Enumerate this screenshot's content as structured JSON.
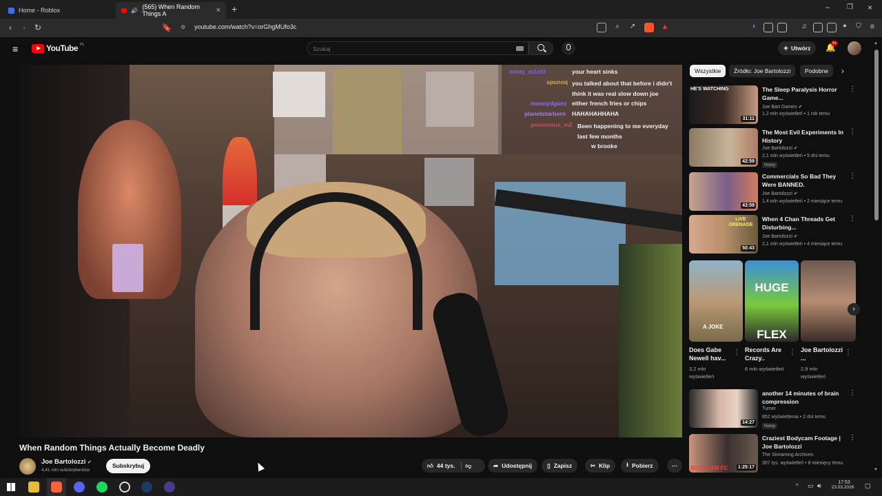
{
  "browser": {
    "tabs": [
      {
        "label": "Home - Roblox"
      },
      {
        "label": "(565) When Random Things A"
      }
    ],
    "url": "youtube.com/watch?v=orGhgMUfo3c"
  },
  "youtube": {
    "logo": "YouTube",
    "country": "PL",
    "search_placeholder": "Szukaj",
    "create_label": "Utwórz",
    "notif_count": "9+"
  },
  "chat": [
    {
      "user": "minty_m1sfit",
      "msg": "your heart sinks",
      "user_color": "#7f5fff"
    },
    {
      "user": "spunoq",
      "msg": "you talked about that before i didn't think it was real slow down joe",
      "user_color": "#e0a64a"
    },
    {
      "user": "mannydguez",
      "msg": "either french fries or chips",
      "user_color": "#8a6bff"
    },
    {
      "user": "planetstarborn",
      "msg": "HAHAHAHHAHA",
      "user_color": "#a57cff"
    },
    {
      "user": "poisonous_m2",
      "msg": "Been happening to me everyday last few months",
      "user_color": "#d24a6b"
    },
    {
      "user": "",
      "msg": "w brooke",
      "user_color": "#c02020"
    }
  ],
  "video": {
    "title": "When Random Things Actually Become Deadly",
    "channel": "Joe Bartolozzi",
    "subscribers": "4,41 mln subskrybentów",
    "subscribe_label": "Subskrybuj",
    "likes": "44 tys.",
    "share_label": "Udostępnij",
    "save_label": "Zapisz",
    "clip_label": "Klip",
    "download_label": "Pobierz"
  },
  "chips": [
    "Wszystkie",
    "Źródło: Joe Bartolozzi",
    "Podobne"
  ],
  "recommendations": [
    {
      "title": "The Sleep Paralysis Horror Game...",
      "channel": "Joe Bart Games",
      "meta": "1,2 mln wyświetleń • 1 rok temu",
      "duration": "31:11",
      "badge": "",
      "thumb_text": "HE'S WATCHING"
    },
    {
      "title": "The Most Evil Experiments In History",
      "channel": "Joe Bartolozzi",
      "meta": "2,1 mln wyświetleń • 5 dni temu",
      "duration": "42:59",
      "badge": "Nowy",
      "thumb_text": ""
    },
    {
      "title": "Commercials So Bad They Were BANNED.",
      "channel": "Joe Bartolozzi",
      "meta": "1,4 mln wyświetleń • 2 miesiące temu",
      "duration": "43:59",
      "badge": "",
      "thumb_text": ""
    },
    {
      "title": "When 4 Chan Threads Get Disturbing...",
      "channel": "Joe Bartolozzi",
      "meta": "2,1 mln wyświetleń • 4 miesiące temu",
      "duration": "50:43",
      "badge": "",
      "thumb_text": "LIVE GRENADE"
    }
  ],
  "shorts": [
    {
      "title": "Does Gabe Newell hav...",
      "views": "3,2 mln wyświetleń",
      "thumb_text": "A JOKE"
    },
    {
      "title": "Records Are Crazy..",
      "views": "6 mln wyświetleń",
      "thumb_text": "HUGE FLEX"
    },
    {
      "title": "Joe Bartolozzi ...",
      "views": "2,9 mln wyświetleń",
      "thumb_text": ""
    }
  ],
  "recommendations2": [
    {
      "title": "another 14 minutes of brain compression",
      "channel": "Tumer",
      "meta": "852 wyświetlenia • 2 dni temu",
      "duration": "14:27",
      "badge": "Nowy"
    },
    {
      "title": "Craziest Bodycam Footage | Joe Bartolozzi",
      "channel": "The Streaming Archives",
      "meta": "307 tys. wyświetleń • 8 miesięcy temu",
      "duration": "1:25:17",
      "badge": "",
      "thumb_text": "BODYCAM FC"
    }
  ],
  "taskbar": {
    "time": "17:53",
    "date": "23.03.2026"
  }
}
